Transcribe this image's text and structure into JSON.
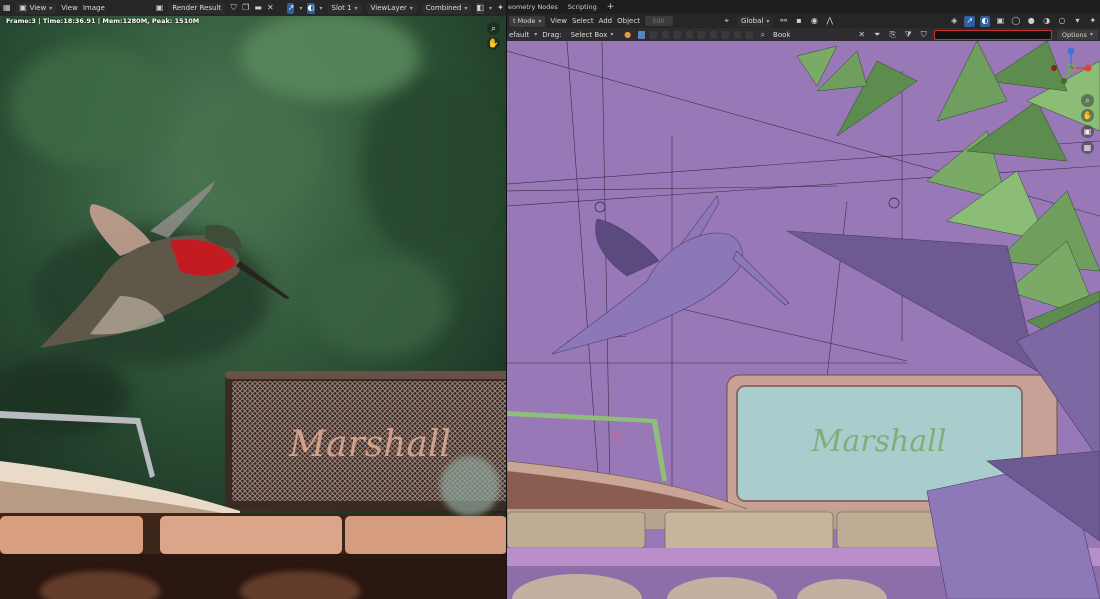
{
  "left": {
    "header": {
      "view_label": "View",
      "menu_view": "View",
      "menu_image": "Image",
      "image_name": "Render Result",
      "slot": "Slot 1",
      "view_layer": "ViewLayer",
      "pass": "Combined"
    },
    "frame_info": "Frame:3 | Time:18:36.91 | Mem:1280M, Peak: 1510M",
    "icons": [
      "editor-type-icon",
      "view-icon",
      "image-browse-icon",
      "shield-icon",
      "new-image-icon",
      "open-folder-icon",
      "close-icon",
      "gizmo-icon",
      "overlay-icon",
      "display-channels-icon",
      "sparkle-icon",
      "zoom-icon",
      "hand-icon"
    ]
  },
  "right": {
    "tabs": [
      {
        "label": "eometry Nodes"
      },
      {
        "label": "Scripting"
      }
    ],
    "tab_add": "+",
    "header": {
      "mode": "t Mode",
      "menu_view": "View",
      "menu_select": "Select",
      "menu_add": "Add",
      "menu_object": "Object",
      "edit_btn": "Edit",
      "transform_orientation": "Global"
    },
    "tool_header": {
      "preset": "efault",
      "drag_label": "Drag:",
      "drag_value": "Select Box",
      "search_value": "Book",
      "options": "Options"
    }
  },
  "colors": {
    "viewport_bg": "#9878b6",
    "header_bg": "#262626",
    "accent_blue": "#2f5f9e",
    "gizmo_x": "#d8473f",
    "gizmo_y": "#67b33a",
    "gizmo_z": "#3c77d4"
  }
}
